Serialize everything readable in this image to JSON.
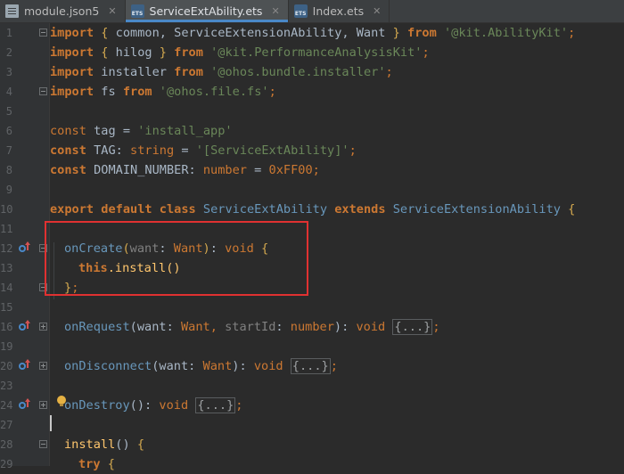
{
  "tabs": [
    {
      "label": "module.json5",
      "active": false,
      "icon": "doc-file-icon"
    },
    {
      "label": "ServiceExtAbility.ets",
      "active": true,
      "icon": "ets-file-icon"
    },
    {
      "label": "Index.ets",
      "active": false,
      "icon": "ets-file-icon"
    }
  ],
  "tab_close": "✕",
  "ets_badge": "ETS",
  "line_numbers": [
    "1",
    "2",
    "3",
    "4",
    "5",
    "6",
    "7",
    "8",
    "9",
    "10",
    "11",
    "12",
    "13",
    "14",
    "15",
    "16",
    "19",
    "20",
    "23",
    "24",
    "27",
    "28",
    "29"
  ],
  "code": {
    "l1": {
      "kw": "import",
      "b1": "{",
      "names": " common, ServiceExtensionAbility, Want ",
      "b2": "}",
      "from": "from",
      "mod": "'@kit.AbilityKit'",
      "semi": ";"
    },
    "l2": {
      "kw": "import",
      "b1": "{",
      "names": " hilog ",
      "b2": "}",
      "from": "from",
      "mod": "'@kit.PerformanceAnalysisKit'",
      "semi": ";"
    },
    "l3": {
      "kw": "import",
      "name": " installer ",
      "from": "from",
      "mod": "'@ohos.bundle.installer'",
      "semi": ";"
    },
    "l4": {
      "kw": "import",
      "name": " fs ",
      "from": "from",
      "mod": "'@ohos.file.fs'",
      "semi": ";"
    },
    "l6": {
      "kw": "const",
      "rest": " tag = ",
      "str": "'install_app'"
    },
    "l7": {
      "kw": "const",
      "name": " TAG",
      "colon": ": ",
      "type": "string",
      "eq": " = ",
      "str": "'[ServiceExtAbility]'",
      "semi": ";"
    },
    "l8": {
      "kw": "const",
      "name": " DOMAIN_NUMBER",
      "colon": ": ",
      "type": "number",
      "eq": " = ",
      "num": "0xFF00",
      "semi": ";"
    },
    "l10": {
      "kw1": "export",
      "kw2": "default",
      "kw3": "class",
      "cls": "ServiceExtAbility",
      "kw4": "extends",
      "base": "ServiceExtensionAbility",
      "brace": "{"
    },
    "l12": {
      "fn": "onCreate",
      "p1": "(",
      "param": "want",
      "colon": ": ",
      "ptype": "Want",
      "p2": ")",
      "rc": ": ",
      "rt": "void",
      "brace": "{"
    },
    "l13": {
      "this": "this",
      "rest": ".install()"
    },
    "l14": {
      "brace": "}",
      "semi": ";"
    },
    "l16": {
      "fn": "onRequest",
      "p1": "(",
      "param1": "want",
      "c1": ": ",
      "t1": "Want",
      "comma": ", ",
      "param2": "startId",
      "c2": ": ",
      "t2": "number",
      "p2": ")",
      "rc": ": ",
      "rt": "void",
      "fold": "{...}",
      "semi": ";"
    },
    "l20": {
      "fn": "onDisconnect",
      "p1": "(",
      "param": "want",
      "colon": ": ",
      "ptype": "Want",
      "p2": ")",
      "rc": ": ",
      "rt": "void",
      "fold": "{...}",
      "semi": ";"
    },
    "l24": {
      "fn": "onDestroy",
      "p1": "()",
      "rc": ": ",
      "rt": "void",
      "fold": "{...}",
      "semi": ";"
    },
    "l28": {
      "fn": "install",
      "p1": "()",
      "brace": "{"
    },
    "l29": {
      "kw": "try",
      "brace": "{"
    }
  },
  "colors": {
    "background": "#2b2b2b",
    "keyword": "#cc7832",
    "string": "#6a8759",
    "type_name": "#6897bb",
    "highlight_box": "#e03131"
  }
}
